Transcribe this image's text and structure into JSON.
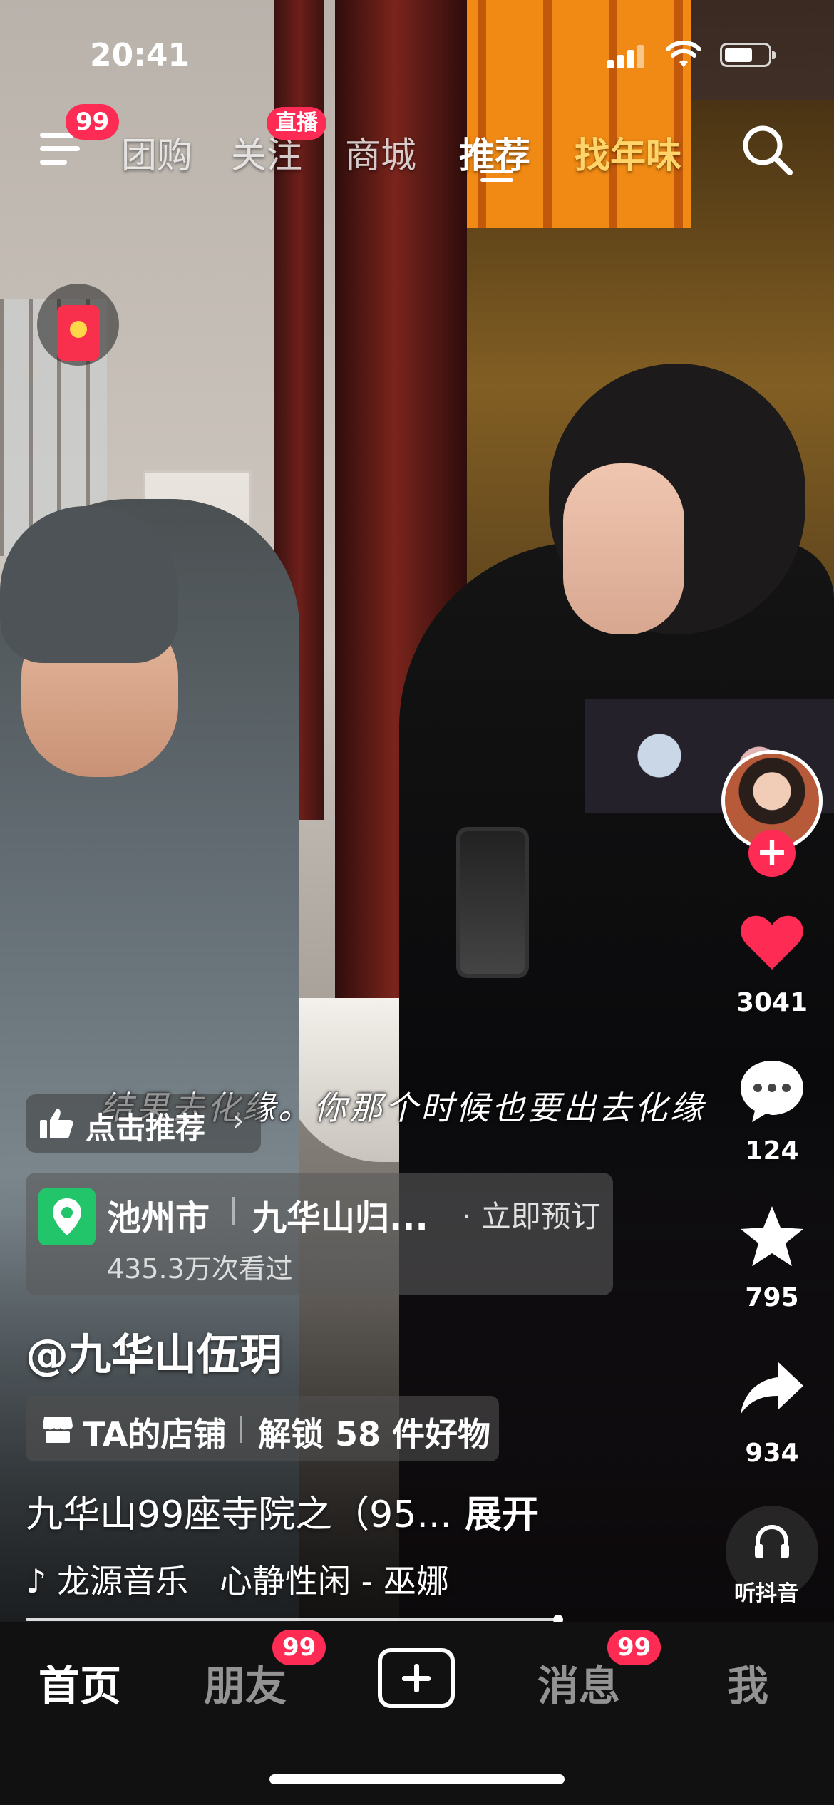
{
  "status_bar": {
    "time": "20:41"
  },
  "top_nav": {
    "menu_badge": "99",
    "tabs": [
      {
        "label": "团购"
      },
      {
        "label": "关注",
        "badge": "直播"
      },
      {
        "label": "商城"
      },
      {
        "label": "推荐",
        "active": true
      },
      {
        "label": "找年味"
      }
    ]
  },
  "video": {
    "subtitle": "结果去化缘。你那个时候也要出去化缘",
    "recommend_label": "点击推荐",
    "location": {
      "city": "池州市",
      "place": "九华山归...",
      "action": "· 立即预订",
      "views": "435.3万次看过"
    },
    "author": "@九华山伍玥",
    "shop": {
      "label": "TA的店铺",
      "unlock": "解锁 58 件好物"
    },
    "description": "九华山99座寺院之（95...",
    "expand_label": "展开",
    "music": {
      "source": "龙源音乐",
      "track": "心静性闲 - 巫娜"
    },
    "progress": 0.68
  },
  "right_rail": {
    "likes": "3041",
    "comments": "124",
    "favorites": "795",
    "shares": "934",
    "listen_label": "听抖音"
  },
  "bottom_tabs": {
    "home": "首页",
    "friends": "朋友",
    "friends_badge": "99",
    "messages": "消息",
    "messages_badge": "99",
    "me": "我"
  },
  "colors": {
    "accent": "#fe2c55",
    "gold_tab": "#ffd56a",
    "location_green": "#22c56a"
  }
}
